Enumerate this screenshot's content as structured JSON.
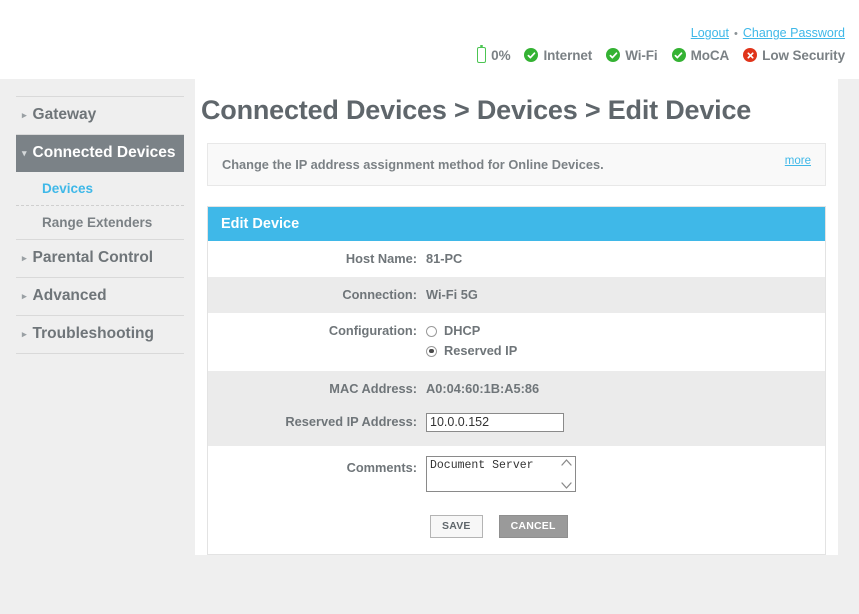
{
  "header": {
    "links": [
      {
        "label": "Logout",
        "name": "logout-link"
      },
      {
        "label": "Change Password",
        "name": "change-password-link"
      }
    ],
    "separator": "•",
    "status": [
      {
        "icon": "battery-icon",
        "label": "0%",
        "type": "battery",
        "color": "#4cc552"
      },
      {
        "icon": "check-circle-icon",
        "label": "Internet",
        "type": "ok",
        "color": "#34b233"
      },
      {
        "icon": "check-circle-icon",
        "label": "Wi-Fi",
        "type": "ok",
        "color": "#34b233"
      },
      {
        "icon": "check-circle-icon",
        "label": "MoCA",
        "type": "ok",
        "color": "#34b233"
      },
      {
        "icon": "error-circle-icon",
        "label": "Low Security",
        "type": "bad",
        "color": "#e0341a"
      }
    ]
  },
  "sidebar": {
    "items": [
      {
        "label": "Gateway",
        "state": "collapsed",
        "arrow": "▸"
      },
      {
        "label": "Connected Devices",
        "state": "expanded",
        "arrow": "▾",
        "active": true
      },
      {
        "label": "Parental Control",
        "state": "collapsed",
        "arrow": "▸"
      },
      {
        "label": "Advanced",
        "state": "collapsed",
        "arrow": "▸"
      },
      {
        "label": "Troubleshooting",
        "state": "collapsed",
        "arrow": "▸"
      }
    ],
    "subitems": [
      {
        "label": "Devices",
        "selected": true
      },
      {
        "label": "Range Extenders",
        "selected": false
      }
    ]
  },
  "main": {
    "title": "Connected Devices > Devices > Edit Device",
    "description": "Change the IP address assignment method for Online Devices.",
    "more_label": "more",
    "panel_title": "Edit Device",
    "fields": {
      "host_name_label": "Host Name:",
      "host_name_value": "81-PC",
      "connection_label": "Connection:",
      "connection_value": "Wi-Fi 5G",
      "configuration_label": "Configuration:",
      "config_option_dhcp": "DHCP",
      "config_option_reserved": "Reserved IP",
      "config_selected": "Reserved IP",
      "mac_label": "MAC Address:",
      "mac_value": "A0:04:60:1B:A5:86",
      "reserved_ip_label": "Reserved IP Address:",
      "reserved_ip_value": "10.0.0.152",
      "comments_label": "Comments:",
      "comments_value": "Document Server"
    },
    "buttons": {
      "save": "SAVE",
      "cancel": "CANCEL"
    }
  },
  "colors": {
    "accent": "#3fb8e8",
    "sidebar_active": "#7b8287",
    "page_bg": "#efefef",
    "row_shade": "#ebebeb",
    "text": "#6f7579"
  }
}
